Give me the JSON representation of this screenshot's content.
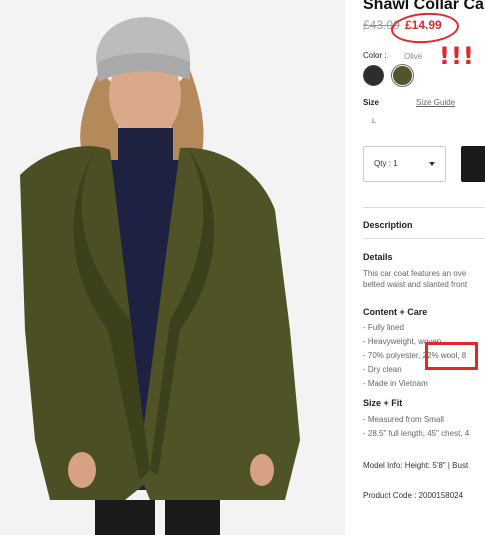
{
  "product": {
    "title": "Shawl Collar Car",
    "price_original": "£43.00",
    "price_sale": "£14.99",
    "annotation_marks": "!!!"
  },
  "color": {
    "label": "Color",
    "separator": ":",
    "selected": "Olive",
    "swatches": [
      "black",
      "olive"
    ]
  },
  "size": {
    "label": "Size",
    "guide_link": "Size Guide",
    "options": [
      "L"
    ]
  },
  "quantity": {
    "label": "Qty : 1"
  },
  "sections": {
    "description": "Description",
    "details_heading": "Details",
    "details_line1": "This car coat features an ove",
    "details_line2": "belted waist and slanted front",
    "care_heading": "Content + Care",
    "care_items": [
      "- Fully lined",
      "- Heavyweight, woven",
      "- 70% polyester, 22% wool, 8",
      "- Dry clean",
      "- Made in Vietnam"
    ],
    "fit_heading": "Size + Fit",
    "fit_items": [
      "- Measured from Small",
      "- 28.5\" full length, 45\" chest, 4"
    ],
    "model_info": "Model Info: Height: 5'8\" | Bust",
    "product_code": "Product Code : 2000158024"
  },
  "colors": {
    "annotation_red": "#e3262b",
    "coat_olive": "#4b4f23",
    "sale_price": "#e0282a"
  }
}
